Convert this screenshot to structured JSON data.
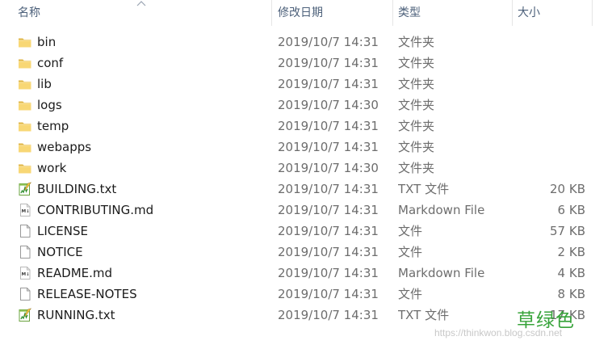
{
  "columns": {
    "name": "名称",
    "date": "修改日期",
    "type": "类型",
    "size": "大小"
  },
  "sort": {
    "column": "name",
    "direction": "ascending"
  },
  "files": [
    {
      "name": "bin",
      "date": "2019/10/7 14:31",
      "type": "文件夹",
      "size": "",
      "icon": "folder-icon"
    },
    {
      "name": "conf",
      "date": "2019/10/7 14:31",
      "type": "文件夹",
      "size": "",
      "icon": "folder-icon"
    },
    {
      "name": "lib",
      "date": "2019/10/7 14:31",
      "type": "文件夹",
      "size": "",
      "icon": "folder-icon"
    },
    {
      "name": "logs",
      "date": "2019/10/7 14:30",
      "type": "文件夹",
      "size": "",
      "icon": "folder-icon"
    },
    {
      "name": "temp",
      "date": "2019/10/7 14:31",
      "type": "文件夹",
      "size": "",
      "icon": "folder-icon"
    },
    {
      "name": "webapps",
      "date": "2019/10/7 14:31",
      "type": "文件夹",
      "size": "",
      "icon": "folder-icon"
    },
    {
      "name": "work",
      "date": "2019/10/7 14:30",
      "type": "文件夹",
      "size": "",
      "icon": "folder-icon"
    },
    {
      "name": "BUILDING.txt",
      "date": "2019/10/7 14:31",
      "type": "TXT 文件",
      "size": "20 KB",
      "icon": "notepad-icon"
    },
    {
      "name": "CONTRIBUTING.md",
      "date": "2019/10/7 14:31",
      "type": "Markdown File",
      "size": "6 KB",
      "icon": "markdown-file-icon"
    },
    {
      "name": "LICENSE",
      "date": "2019/10/7 14:31",
      "type": "文件",
      "size": "57 KB",
      "icon": "blank-file-icon"
    },
    {
      "name": "NOTICE",
      "date": "2019/10/7 14:31",
      "type": "文件",
      "size": "2 KB",
      "icon": "blank-file-icon"
    },
    {
      "name": "README.md",
      "date": "2019/10/7 14:31",
      "type": "Markdown File",
      "size": "4 KB",
      "icon": "markdown-file-icon"
    },
    {
      "name": "RELEASE-NOTES",
      "date": "2019/10/7 14:31",
      "type": "文件",
      "size": "8 KB",
      "icon": "blank-file-icon"
    },
    {
      "name": "RUNNING.txt",
      "date": "2019/10/7 14:31",
      "type": "TXT 文件",
      "size": "17 KB",
      "icon": "notepad-icon"
    }
  ],
  "watermark": {
    "text": "草绿色",
    "url": "https://thinkwon.blog.csdn.net",
    "color": "#37a33a"
  },
  "colors": {
    "header_text": "#4c607a",
    "name_text": "#1b1b1b",
    "detail_text": "#6d6d6d",
    "folder": "#f8d775"
  }
}
